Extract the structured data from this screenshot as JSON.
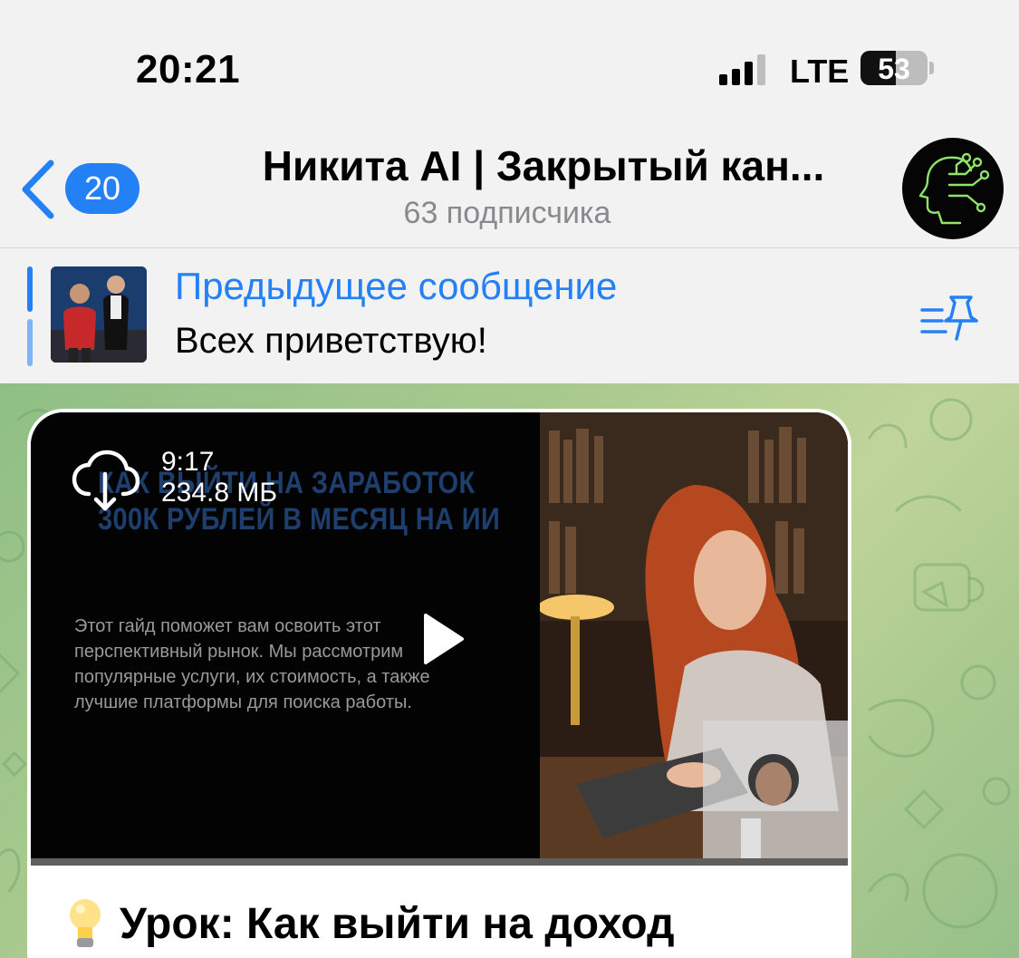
{
  "status_bar": {
    "time": "20:21",
    "network": "LTE",
    "battery": "53"
  },
  "header": {
    "back_badge": "20",
    "title": "Никита AI | Закрытый кан...",
    "subtitle": "63 подписчика"
  },
  "pinned": {
    "title": "Предыдущее сообщение",
    "text": "Всех приветствую!"
  },
  "message": {
    "video": {
      "duration": "9:17",
      "size": "234.8 МБ",
      "thumb_headline": "КАК ВЫЙТИ НА ЗАРАБОТОК 300К РУБЛЕЙ В МЕСЯЦ НА ИИ",
      "thumb_paragraph": "Этот гайд поможет вам освоить этот перспективный рынок. Мы рассмотрим популярные услуги, их стоимость, а также лучшие платформы для поиска работы."
    },
    "caption": "Урок: Как выйти на доход"
  },
  "colors": {
    "accent": "#2481f5",
    "badge_text": "#ffffff"
  },
  "icons": [
    "back-chevron-icon",
    "signal-icon",
    "battery-icon",
    "pinned-list-icon",
    "download-icon",
    "play-icon",
    "lightbulb-icon"
  ]
}
